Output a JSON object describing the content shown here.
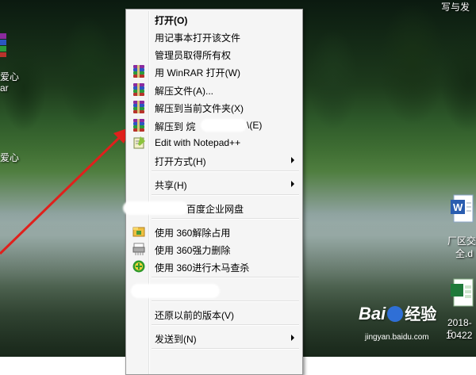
{
  "desktop": {
    "top_right_label": "写与发",
    "left_labels": [
      "爱心",
      "ar",
      "爱心"
    ],
    "right_file_1": {
      "line1": "厂区交",
      "line2": "全.d"
    },
    "right_file_2": {
      "line1": "2018-5",
      "line2": "10422"
    }
  },
  "context_menu": {
    "items": [
      {
        "label": "打开(O)",
        "bold": true
      },
      {
        "label": "用记事本打开该文件"
      },
      {
        "label": "管理员取得所有权"
      },
      {
        "label": "用 WinRAR 打开(W)",
        "icon": "winrar-icon"
      },
      {
        "label": "解压文件(A)...",
        "icon": "winrar-icon"
      },
      {
        "label": "解压到当前文件夹(X)",
        "icon": "winrar-icon"
      },
      {
        "label": "解压到 烷",
        "label_tail": "\\(E)",
        "icon": "winrar-icon"
      },
      {
        "label": "Edit with Notepad++",
        "icon": "notepad-plus-icon"
      },
      {
        "label": "打开方式(H)",
        "submenu": true
      },
      {
        "label": "共享(H)",
        "submenu": true
      },
      {
        "label": "百度企业网盘"
      },
      {
        "label": "使用 360解除占用",
        "icon": "360-unlock-icon"
      },
      {
        "label": "使用 360强力删除",
        "icon": "360-shred-icon"
      },
      {
        "label": "使用 360进行木马查杀",
        "icon": "360-scan-icon"
      },
      {
        "label": "还原以前的版本(V)"
      },
      {
        "label": "发送到(N)",
        "submenu": true
      }
    ]
  },
  "watermark": {
    "brand": "Bai",
    "brand2": "经验",
    "url": "jingyan.baidu.com"
  },
  "colors": {
    "menu_bg": "#f5f5f5",
    "annotation_arrow": "#e0201c"
  }
}
